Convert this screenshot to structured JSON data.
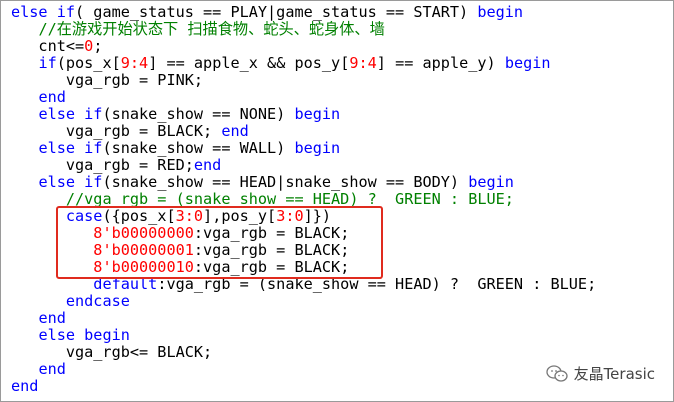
{
  "lines": [
    {
      "t": [
        [
          "kw",
          "else if"
        ],
        [
          "",
          "( game_status == PLAY|game_status == START) "
        ],
        [
          "kw",
          "begin"
        ]
      ]
    },
    {
      "t": [
        [
          "",
          "   "
        ],
        [
          "cm",
          "//在游戏开始状态下 扫描食物、蛇头、蛇身体、墙"
        ]
      ]
    },
    {
      "t": [
        [
          "",
          "   cnt<="
        ],
        [
          "num",
          "0"
        ],
        [
          "",
          ";"
        ]
      ]
    },
    {
      "t": [
        [
          "",
          "   "
        ],
        [
          "kw",
          "if"
        ],
        [
          "",
          "(pos_x["
        ],
        [
          "num",
          "9:4"
        ],
        [
          "",
          "] == apple_x && pos_y["
        ],
        [
          "num",
          "9:4"
        ],
        [
          "",
          "] == apple_y) "
        ],
        [
          "kw",
          "begin"
        ]
      ]
    },
    {
      "t": [
        [
          "",
          "      vga_rgb = PINK;"
        ]
      ]
    },
    {
      "t": [
        [
          "",
          "   "
        ],
        [
          "kw",
          "end"
        ]
      ]
    },
    {
      "t": [
        [
          "",
          "   "
        ],
        [
          "kw",
          "else if"
        ],
        [
          "",
          "(snake_show == NONE) "
        ],
        [
          "kw",
          "begin"
        ]
      ]
    },
    {
      "t": [
        [
          "",
          "      vga_rgb = BLACK; "
        ],
        [
          "kw",
          "end"
        ]
      ]
    },
    {
      "t": [
        [
          "",
          "   "
        ],
        [
          "kw",
          "else if"
        ],
        [
          "",
          "(snake_show == WALL) "
        ],
        [
          "kw",
          "begin"
        ]
      ]
    },
    {
      "t": [
        [
          "",
          "      vga_rgb = RED;"
        ],
        [
          "kw",
          "end"
        ]
      ]
    },
    {
      "t": [
        [
          "",
          "   "
        ],
        [
          "kw",
          "else if"
        ],
        [
          "",
          "(snake_show == HEAD|snake_show == BODY) "
        ],
        [
          "kw",
          "begin"
        ]
      ]
    },
    {
      "t": [
        [
          "",
          "      "
        ],
        [
          "cm",
          "//vga_rgb = (snake_show == HEAD) ?  GREEN : BLUE;"
        ]
      ]
    },
    {
      "t": [
        [
          "",
          "      "
        ],
        [
          "kw",
          "case"
        ],
        [
          "",
          "({pos_x["
        ],
        [
          "num",
          "3:0"
        ],
        [
          "",
          "],pos_y["
        ],
        [
          "num",
          "3:0"
        ],
        [
          "",
          "]})"
        ]
      ]
    },
    {
      "t": [
        [
          "",
          "         "
        ],
        [
          "num",
          "8'b00000000"
        ],
        [
          "",
          ":vga_rgb = BLACK;"
        ]
      ]
    },
    {
      "t": [
        [
          "",
          "         "
        ],
        [
          "num",
          "8'b00000001"
        ],
        [
          "",
          ":vga_rgb = BLACK;"
        ]
      ]
    },
    {
      "t": [
        [
          "",
          "         "
        ],
        [
          "num",
          "8'b00000010"
        ],
        [
          "",
          ":vga_rgb = BLACK;"
        ]
      ]
    },
    {
      "t": [
        [
          "",
          "         "
        ],
        [
          "kw",
          "default"
        ],
        [
          "",
          ":vga_rgb = (snake_show == HEAD) ?  GREEN : BLUE;"
        ]
      ]
    },
    {
      "t": [
        [
          "",
          "      "
        ],
        [
          "kw",
          "endcase"
        ]
      ]
    },
    {
      "t": [
        [
          "",
          "   "
        ],
        [
          "kw",
          "end"
        ]
      ]
    },
    {
      "t": [
        [
          "",
          "   "
        ],
        [
          "kw",
          "else begin"
        ]
      ]
    },
    {
      "t": [
        [
          "",
          "      vga_rgb<= BLACK;"
        ]
      ]
    },
    {
      "t": [
        [
          "",
          "   "
        ],
        [
          "kw",
          "end"
        ]
      ]
    },
    {
      "t": [
        [
          "kw",
          "end"
        ]
      ]
    }
  ],
  "colors": {
    "keyword": "#0000ff",
    "comment": "#008000",
    "number": "#ff0000",
    "highlight": "#e02b1e"
  },
  "watermark": {
    "icon": "wechat-icon",
    "text": "友晶Terasic"
  }
}
